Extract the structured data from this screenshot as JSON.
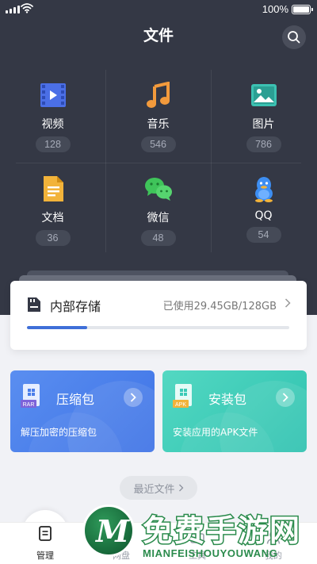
{
  "status_bar": {
    "battery": "100%"
  },
  "header": {
    "title": "文件"
  },
  "categories": [
    {
      "label": "视频",
      "count": "128"
    },
    {
      "label": "音乐",
      "count": "546"
    },
    {
      "label": "图片",
      "count": "786"
    },
    {
      "label": "文档",
      "count": "36"
    },
    {
      "label": "微信",
      "count": "48"
    },
    {
      "label": "QQ",
      "count": "54"
    }
  ],
  "storage": {
    "title": "内部存储",
    "used_text": "已使用29.45GB/128GB",
    "used_fraction": 0.23
  },
  "cards": [
    {
      "title": "压缩包",
      "desc": "解压加密的压缩包",
      "file_tag": "RAR",
      "color": "#4a7ee9"
    },
    {
      "title": "安装包",
      "desc": "安装应用的APK文件",
      "file_tag": "APK",
      "color": "#3ccbb7"
    }
  ],
  "recent": {
    "label": "最近文件"
  },
  "tabbar": {
    "tabs": [
      {
        "label": "管理"
      },
      {
        "label": "网盘"
      },
      {
        "label": "工具"
      },
      {
        "label": "我的"
      }
    ]
  },
  "watermark": {
    "title": "免费手游网",
    "subtitle": "MIANFEISHOUYOUWANG",
    "logo_letter": "M"
  },
  "colors": {
    "header_bg": "#343845",
    "accent": "#3f6fd8"
  }
}
